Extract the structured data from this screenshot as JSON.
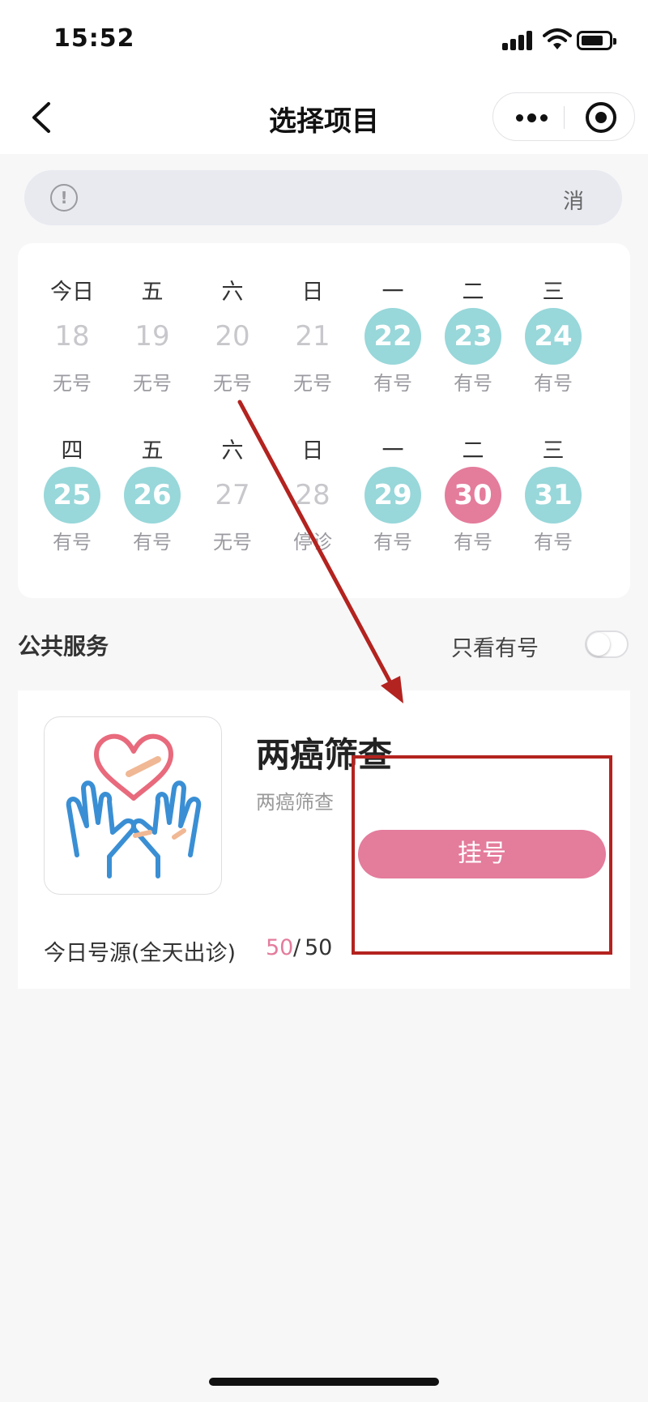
{
  "status_bar": {
    "time": "15:52",
    "icons": [
      "signal-icon",
      "wifi-icon",
      "battery-icon"
    ]
  },
  "nav": {
    "title": "选择项目",
    "icons": [
      "back-icon",
      "more-icon",
      "target-icon"
    ]
  },
  "notice": {
    "text": "消",
    "icon": "info-icon"
  },
  "calendar": {
    "weeks": [
      [
        {
          "weekday": "今日",
          "date": "18",
          "status": "无号",
          "state": "none"
        },
        {
          "weekday": "五",
          "date": "19",
          "status": "无号",
          "state": "none"
        },
        {
          "weekday": "六",
          "date": "20",
          "status": "无号",
          "state": "none"
        },
        {
          "weekday": "日",
          "date": "21",
          "status": "无号",
          "state": "none"
        },
        {
          "weekday": "一",
          "date": "22",
          "status": "有号",
          "state": "avail"
        },
        {
          "weekday": "二",
          "date": "23",
          "status": "有号",
          "state": "avail"
        },
        {
          "weekday": "三",
          "date": "24",
          "status": "有号",
          "state": "avail"
        }
      ],
      [
        {
          "weekday": "四",
          "date": "25",
          "status": "有号",
          "state": "avail"
        },
        {
          "weekday": "五",
          "date": "26",
          "status": "有号",
          "state": "avail"
        },
        {
          "weekday": "六",
          "date": "27",
          "status": "无号",
          "state": "none"
        },
        {
          "weekday": "日",
          "date": "28",
          "status": "停诊",
          "state": "none"
        },
        {
          "weekday": "一",
          "date": "29",
          "status": "有号",
          "state": "avail"
        },
        {
          "weekday": "二",
          "date": "30",
          "status": "有号",
          "state": "selected"
        },
        {
          "weekday": "三",
          "date": "31",
          "status": "有号",
          "state": "avail"
        }
      ]
    ]
  },
  "section": {
    "title": "公共服务",
    "filter_label": "只看有号",
    "filter_on": false
  },
  "service": {
    "name": "两癌筛查",
    "desc": "两癌筛查",
    "button_label": "挂号",
    "quota_label": "今日号源(全天出诊)",
    "quota_remaining": "50",
    "quota_separator": "/",
    "quota_total": "50",
    "logo_icon": "heart-hands-icon"
  },
  "colors": {
    "accent_pink": "#e47c9c",
    "available_teal": "#98d7da",
    "annotation_red": "#b3231f"
  }
}
